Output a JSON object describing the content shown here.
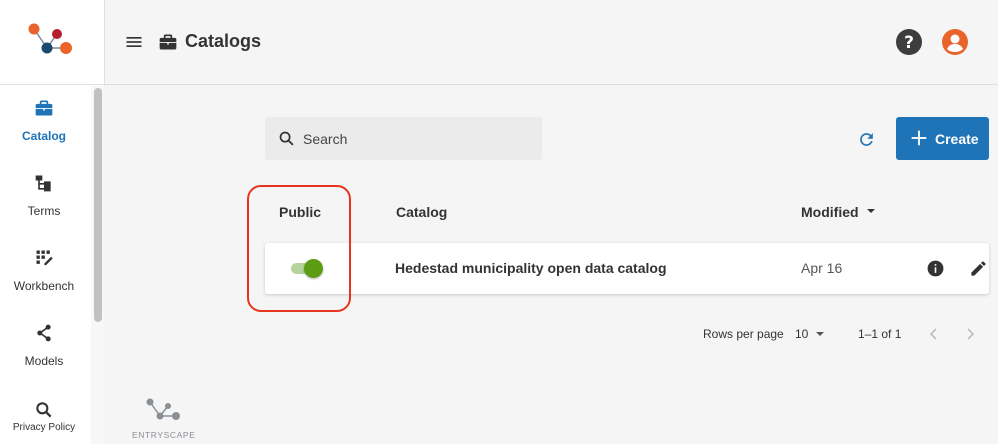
{
  "header": {
    "title": "Catalogs"
  },
  "sidebar": {
    "items": [
      {
        "label": "Catalog"
      },
      {
        "label": "Terms"
      },
      {
        "label": "Workbench"
      },
      {
        "label": "Models"
      },
      {
        "label": "Privacy Policy"
      }
    ],
    "brand": "ENTRYSCAPE"
  },
  "toolbar": {
    "search_placeholder": "Search",
    "create_label": "Create"
  },
  "table": {
    "columns": [
      "Public",
      "Catalog",
      "Modified"
    ],
    "rows": [
      {
        "public": true,
        "name": "Hedestad municipality open data catalog",
        "modified": "Apr 16"
      }
    ]
  },
  "pagination": {
    "rows_per_page_label": "Rows per page",
    "rows_per_page_value": "10",
    "range": "1–1 of 1"
  },
  "colors": {
    "accent": "#1f73b7",
    "toggle_on": "#5b9c13",
    "highlight": "#e8341c",
    "user_avatar": "#e8642b"
  }
}
